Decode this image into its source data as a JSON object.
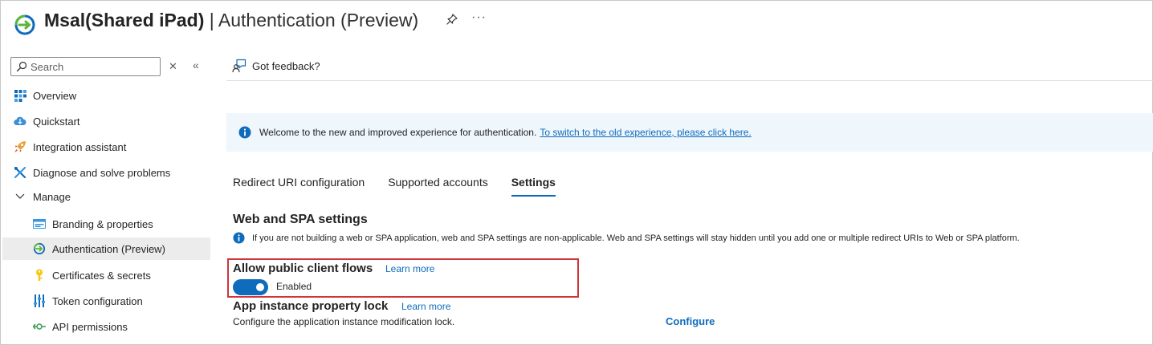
{
  "header": {
    "app_name": "Msal(Shared iPad)",
    "separator": "|",
    "page_title": "Authentication (Preview)",
    "more_label": "···"
  },
  "sidebar": {
    "search_placeholder": "Search",
    "items": [
      {
        "label": "Overview",
        "icon": "grid-icon"
      },
      {
        "label": "Quickstart",
        "icon": "cloud-icon"
      },
      {
        "label": "Integration assistant",
        "icon": "rocket-icon"
      },
      {
        "label": "Diagnose and solve problems",
        "icon": "wrench-icon"
      },
      {
        "label": "Manage",
        "icon": "chevron-down-icon"
      },
      {
        "label": "Branding & properties",
        "icon": "branding-icon"
      },
      {
        "label": "Authentication (Preview)",
        "icon": "authentication-icon",
        "selected": true
      },
      {
        "label": "Certificates & secrets",
        "icon": "key-icon"
      },
      {
        "label": "Token configuration",
        "icon": "token-bars-icon"
      },
      {
        "label": "API permissions",
        "icon": "api-permissions-icon"
      }
    ]
  },
  "main": {
    "feedback_label": "Got feedback?",
    "banner": {
      "text": "Welcome to the new and improved experience for authentication.",
      "link": "To switch to the old experience, please click here."
    },
    "tabs": [
      {
        "label": "Redirect URI configuration",
        "active": false
      },
      {
        "label": "Supported accounts",
        "active": false
      },
      {
        "label": "Settings",
        "active": true
      }
    ],
    "web_spa": {
      "title": "Web and SPA settings",
      "info": "If you are not building a web or SPA application, web and SPA settings are non-applicable. Web and SPA settings will stay hidden until you add one or multiple redirect URIs to Web or SPA platform."
    },
    "public_client": {
      "title": "Allow public client flows",
      "learn_more": "Learn more",
      "toggle_state": "Enabled",
      "enabled": true
    },
    "app_instance_lock": {
      "title": "App instance property lock",
      "learn_more": "Learn more",
      "description": "Configure the application instance modification lock.",
      "action": "Configure"
    }
  },
  "colors": {
    "accent": "#0f6cbd",
    "highlight": "#d13438",
    "banner_bg": "#eff6fc",
    "selected_bg": "#ececec"
  }
}
